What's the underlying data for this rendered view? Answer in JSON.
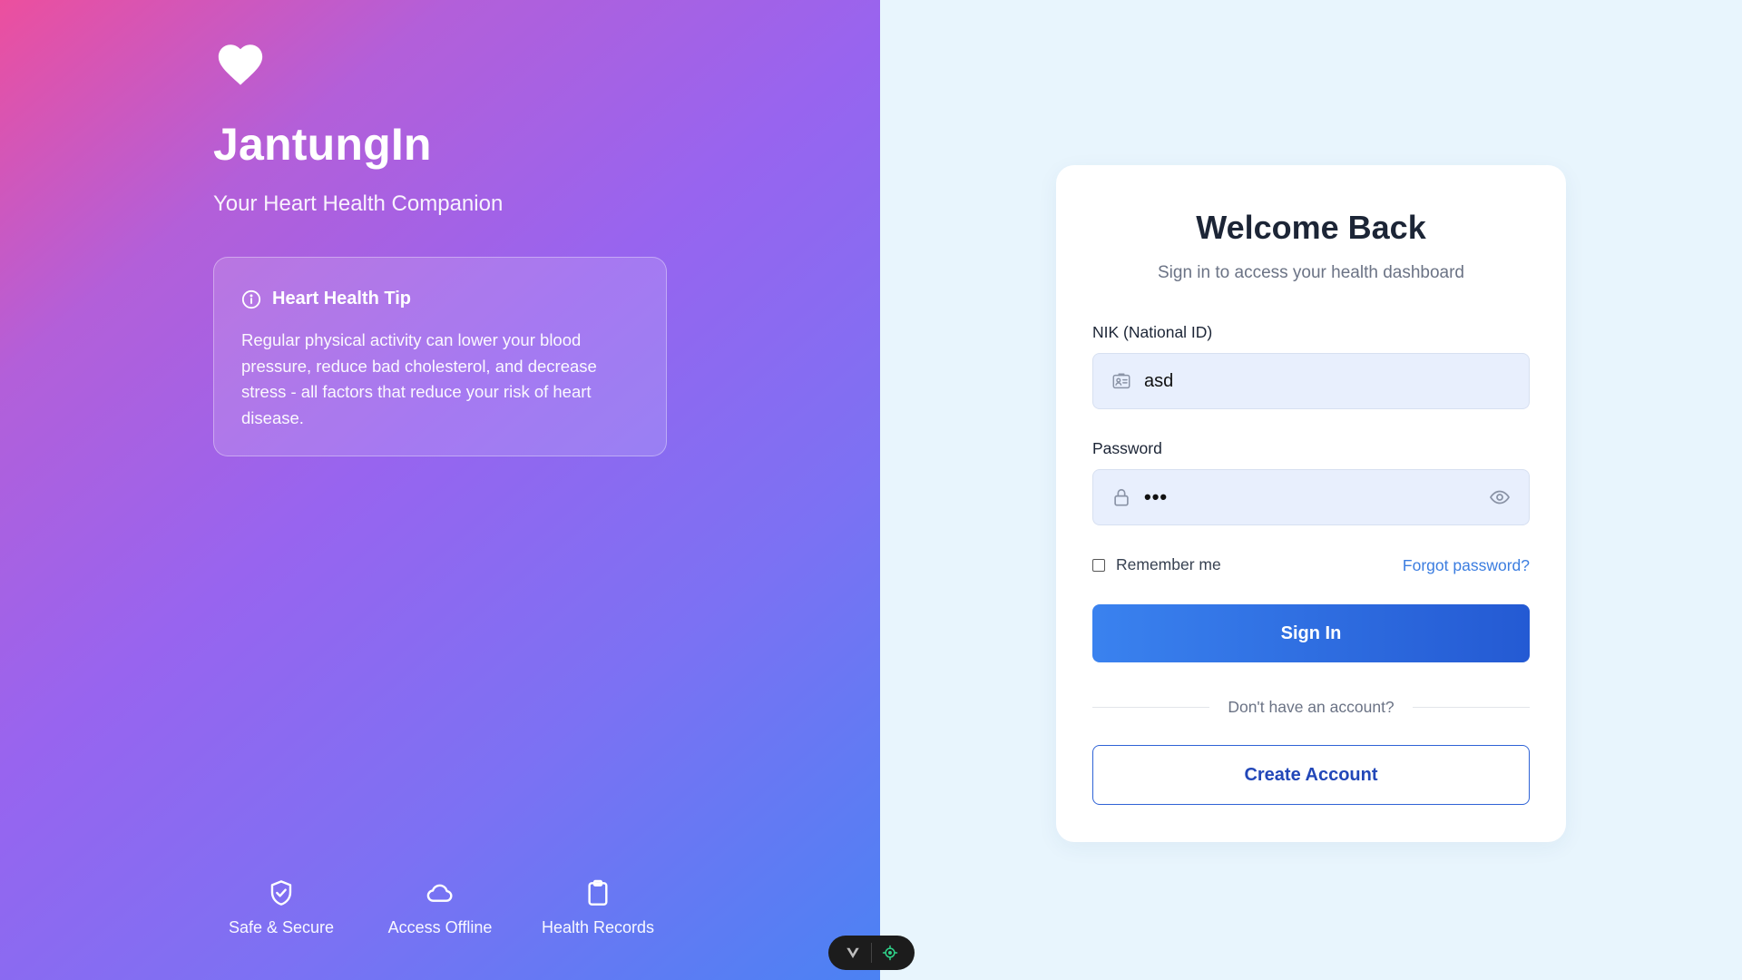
{
  "brand": {
    "name": "JantungIn",
    "tagline": "Your Heart Health Companion",
    "logo_icon": "heart-icon"
  },
  "tip": {
    "title": "Heart Health Tip",
    "icon": "info-icon",
    "body": "Regular physical activity can lower your blood pressure, reduce bad cholesterol, and decrease stress - all factors that reduce your risk of heart disease."
  },
  "features": [
    {
      "label": "Safe & Secure",
      "icon": "shield-check-icon"
    },
    {
      "label": "Access Offline",
      "icon": "cloud-icon"
    },
    {
      "label": "Health Records",
      "icon": "clipboard-icon"
    }
  ],
  "login": {
    "title": "Welcome Back",
    "subtitle": "Sign in to access your health dashboard",
    "nik_label": "NIK (National ID)",
    "nik_value": "asd",
    "password_label": "Password",
    "password_value": "•••",
    "remember_label": "Remember me",
    "remember_checked": false,
    "forgot_label": "Forgot password?",
    "signin_label": "Sign In",
    "no_account_text": "Don't have an account?",
    "create_label": "Create Account"
  },
  "colors": {
    "gradient_start": "#ec4f9e",
    "gradient_mid": "#9864ef",
    "gradient_end": "#4b82f3",
    "primary": "#3a82ef",
    "page_background": "#e8f5fd"
  }
}
